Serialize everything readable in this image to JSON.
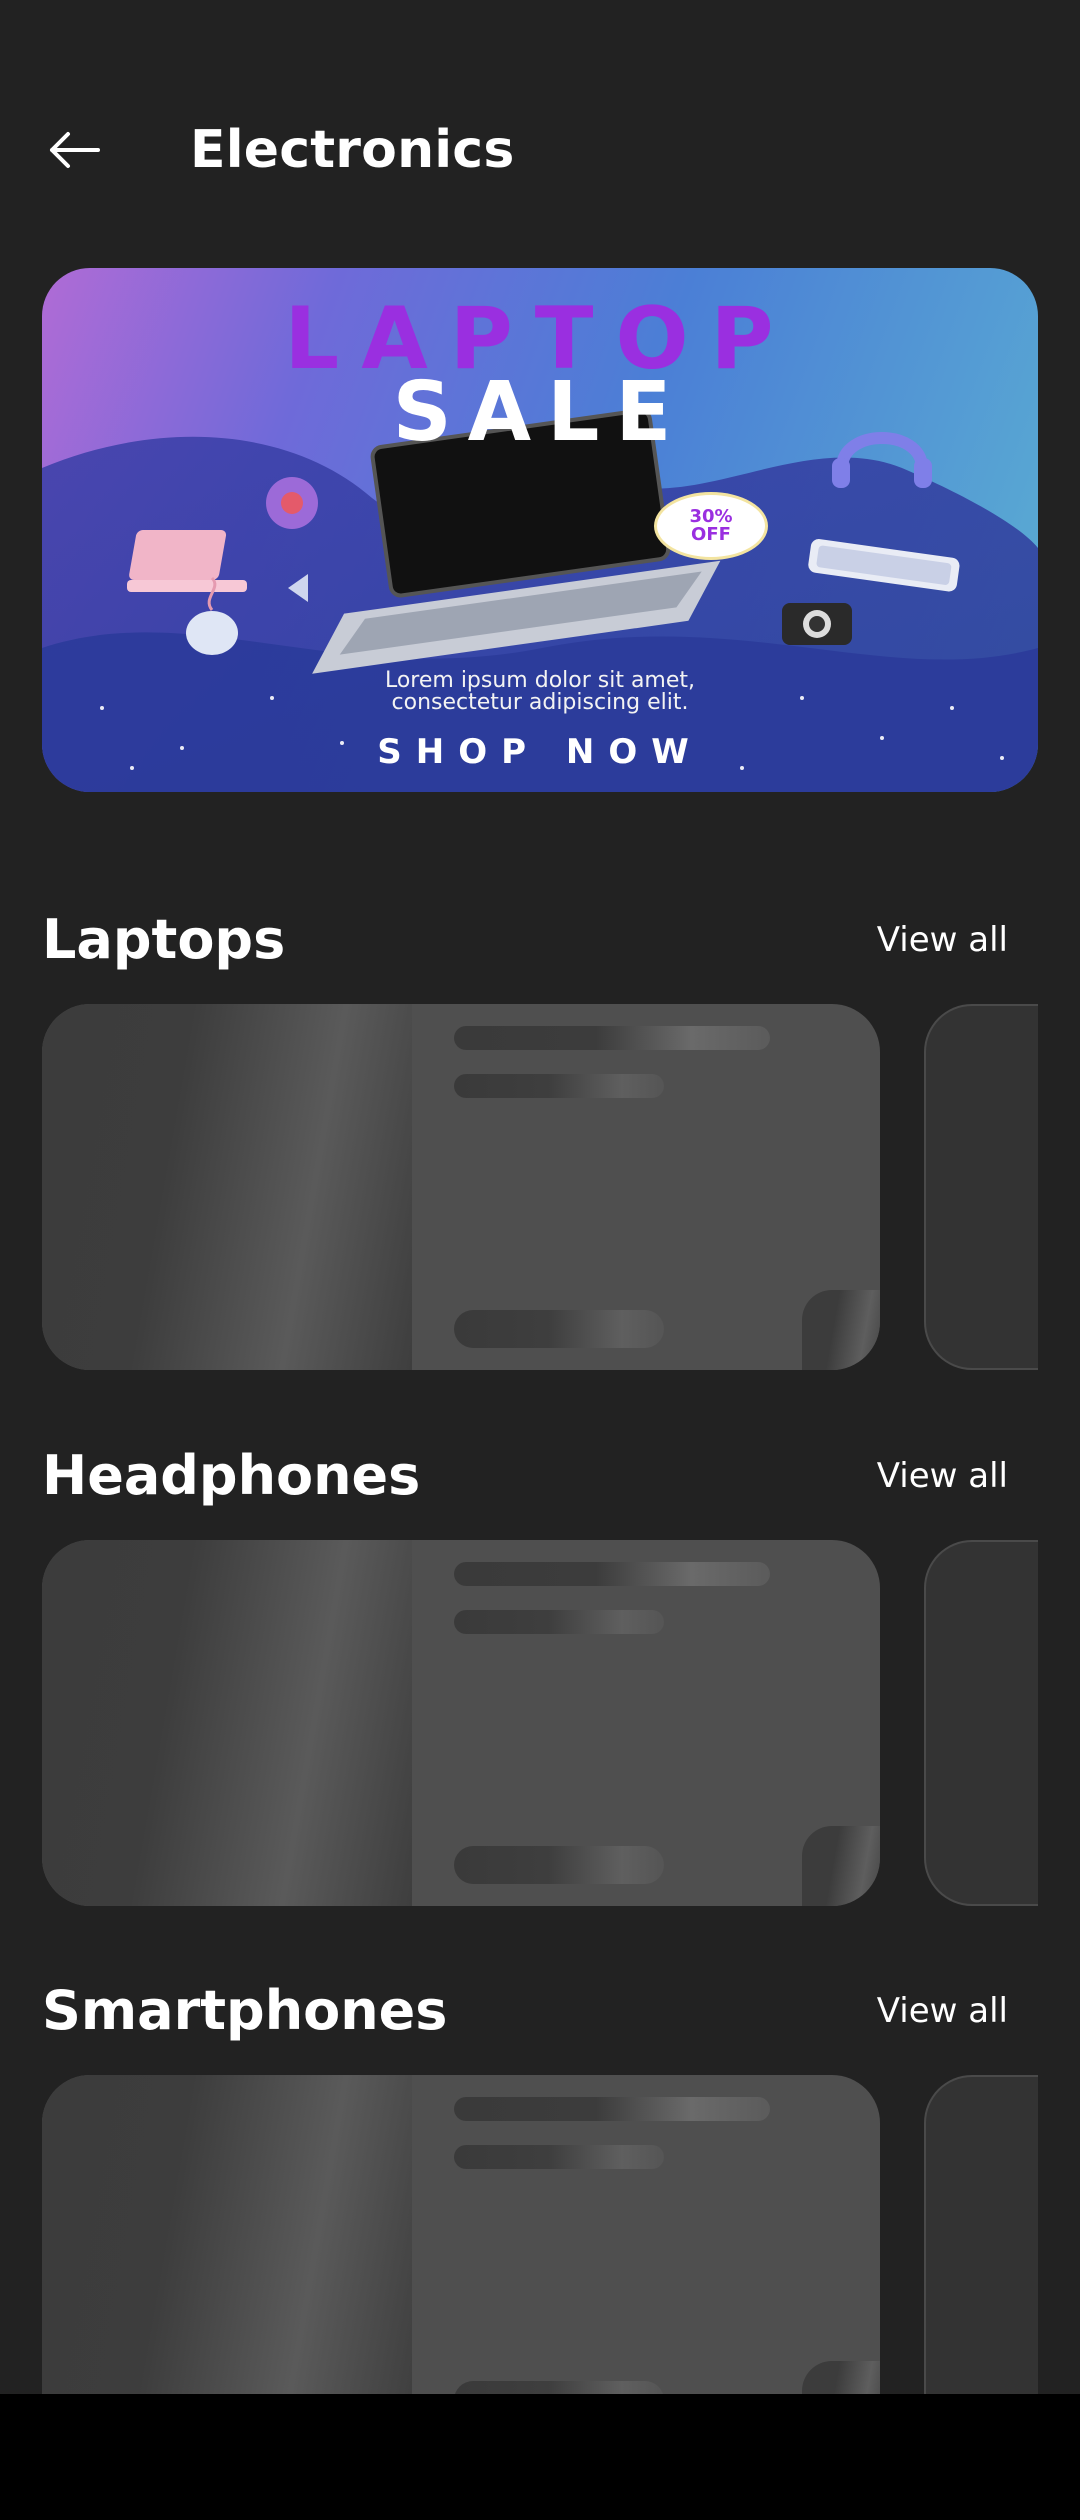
{
  "app_bar": {
    "title": "Electronics",
    "back_icon": "arrow-left-icon"
  },
  "banner": {
    "line1": "LAPTOP",
    "line2": "SALE",
    "discount_line1": "30%",
    "discount_line2": "OFF",
    "body_line1": "Lorem ipsum dolor sit amet,",
    "body_line2": "consectetur adipiscing elit.",
    "cta": "SHOP NOW"
  },
  "sections": [
    {
      "title": "Laptops",
      "view_all": "View all"
    },
    {
      "title": "Headphones",
      "view_all": "View all"
    },
    {
      "title": "Smartphones",
      "view_all": "View all"
    }
  ],
  "colors": {
    "background": "#222222",
    "card": "#4f4f4f",
    "banner_accent": "#9a2fe0",
    "text": "#ffffff"
  }
}
